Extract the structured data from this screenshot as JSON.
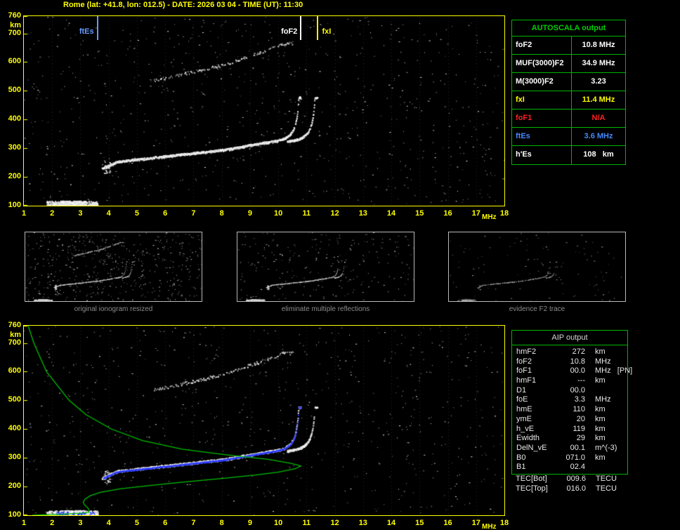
{
  "header": {
    "title": "Rome (lat: +41.8, lon: 012.5) - DATE: 2026 03 04 - TIME (UT): 11:30"
  },
  "colors": {
    "axis": "#ffff00",
    "table_border": "#00b400",
    "profile_line": "#00c000",
    "fitted_trace": "#2d3cff",
    "autoscala_title": "#00cc00"
  },
  "axes": {
    "y_unit": "km",
    "x_unit": "MHz",
    "y_ticks": [
      760,
      700,
      600,
      500,
      400,
      300,
      200,
      100
    ],
    "x_ticks": [
      1,
      2,
      3,
      4,
      5,
      6,
      7,
      8,
      9,
      10,
      11,
      12,
      13,
      14,
      15,
      16,
      17,
      18
    ],
    "x_range_mhz": [
      1,
      18
    ],
    "y_range_km": [
      100,
      760
    ]
  },
  "top_plot": {
    "markers": [
      {
        "label": "ftEs",
        "freq": 3.6,
        "color": "#6699ff",
        "side": "left"
      },
      {
        "label": "foF2",
        "freq": 10.8,
        "color": "#ffffff",
        "side": "left"
      },
      {
        "label": "fxI",
        "freq": 11.4,
        "color": "#ffff00",
        "side": "right"
      }
    ]
  },
  "autoscala": {
    "title": "AUTOSCALA output",
    "rows": [
      {
        "param": "foF2",
        "value": "10.8 MHz",
        "color": "#ffffff"
      },
      {
        "param": "MUF(3000)F2",
        "value": "34.9 MHz",
        "color": "#ffffff"
      },
      {
        "param": "M(3000)F2",
        "value": "3.23",
        "color": "#ffffff"
      },
      {
        "param": "fxI",
        "value": "11.4 MHz",
        "color": "#ffff00"
      },
      {
        "param": "foF1",
        "value": "N/A",
        "color": "#ff2020"
      },
      {
        "param": "ftEs",
        "value": "3.6 MHz",
        "color": "#4488ff"
      },
      {
        "param": "h'Es",
        "value": "108   km",
        "color": "#ffffff"
      }
    ]
  },
  "thumbnails": [
    {
      "caption": "original ionogram resized"
    },
    {
      "caption": "eliminate multiple reflections"
    },
    {
      "caption": "evidence F2 trace"
    }
  ],
  "aip": {
    "title": "AIP output",
    "rows": [
      {
        "param": "hmF2",
        "value": "272",
        "unit": "km"
      },
      {
        "param": "foF2",
        "value": "10.8",
        "unit": "MHz"
      },
      {
        "param": "foF1",
        "value": "00.0",
        "unit": "MHz   [PN]"
      },
      {
        "param": "hmF1",
        "value": "---",
        "unit": "km"
      },
      {
        "param": "D1",
        "value": "00.0",
        "unit": ""
      },
      {
        "param": "foE",
        "value": "3.3",
        "unit": "MHz"
      },
      {
        "param": "hmE",
        "value": "110",
        "unit": "km"
      },
      {
        "param": "ymE",
        "value": "20",
        "unit": "km"
      },
      {
        "param": "h_vE",
        "value": "119",
        "unit": "km"
      },
      {
        "param": "Ewidth",
        "value": "29",
        "unit": "km"
      },
      {
        "param": "DelN_vE",
        "value": "00.1",
        "unit": "m^(-3)"
      },
      {
        "param": "B0",
        "value": "071.0",
        "unit": "km"
      },
      {
        "param": "B1",
        "value": "02.4",
        "unit": ""
      }
    ],
    "tec_rows": [
      {
        "param": "TEC[Bot]",
        "value": "009.6",
        "unit": "TECU"
      },
      {
        "param": "TEC[Top]",
        "value": "016.0",
        "unit": "TECU"
      }
    ]
  }
}
